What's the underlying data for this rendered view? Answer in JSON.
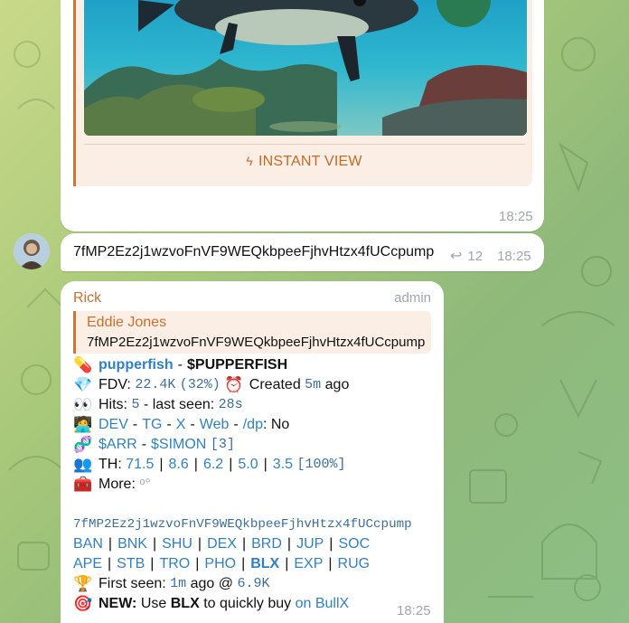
{
  "colors": {
    "accent": "#cd6f2e",
    "link": "#2f82c5",
    "code": "#3a6f9f",
    "time": "#a0a5aa"
  },
  "message1": {
    "instant_view_label": "INSTANT VIEW",
    "time": "18:25"
  },
  "message2": {
    "text": "7fMP2Ez2j1wzvoFnVF9WEQkbpeeFjhvHtzx4fUCcpump",
    "forwards": "12",
    "time": "18:25"
  },
  "message3": {
    "sender": "Rick",
    "role": "admin",
    "reply_name": "Eddie Jones",
    "reply_text": "7fMP2Ez2j1wzvoFnVF9WEQkbpeeFjhvHtzx4fUCcpump",
    "token_name": "pupperfish",
    "token_ticker": "$PUPPERFISH",
    "fdv_label": "FDV:",
    "fdv_value": "22.4K",
    "fdv_change": "(32%)",
    "created_label": "Created",
    "created_value": "5m",
    "created_suffix": "ago",
    "hits_label": "Hits:",
    "hits_value": "5",
    "last_seen_label": "- last seen:",
    "last_seen_value": "28s",
    "links": [
      "DEV",
      "TG",
      "X",
      "Web",
      "/dp"
    ],
    "dp_value": ": No",
    "tickers": [
      "$ARR",
      "$SIMON"
    ],
    "tickers_count": "[3]",
    "th_label": "TH:",
    "th_values": [
      "71.5",
      "8.6",
      "6.2",
      "5.0",
      "3.5"
    ],
    "th_total": "[100%]",
    "more_label": "More:",
    "contract": "7fMP2Ez2j1wzvoFnVF9WEQkbpeeFjhvHtzx4fUCcpump",
    "bots_row1": [
      "BAN",
      "BNK",
      "SHU",
      "DEX",
      "BRD",
      "JUP",
      "SOC"
    ],
    "bots_row2": [
      "APE",
      "STB",
      "TRO",
      "PHO",
      "BLX",
      "EXP",
      "RUG"
    ],
    "first_seen_label": "First seen:",
    "first_seen_value": "1m",
    "first_seen_mid": "ago @",
    "first_seen_mc": "6.9K",
    "new_label": "NEW:",
    "new_text_1": "Use",
    "new_bold": "BLX",
    "new_text_2": "to quickly buy",
    "new_link": "on BullX",
    "time": "18:25"
  },
  "icons": [
    "pill-icon",
    "diamond-icon",
    "clock-icon",
    "eyes-icon",
    "technologist-icon",
    "dna-icon",
    "users-icon",
    "toolbox-icon",
    "trophy-icon",
    "target-icon",
    "share-icon"
  ]
}
